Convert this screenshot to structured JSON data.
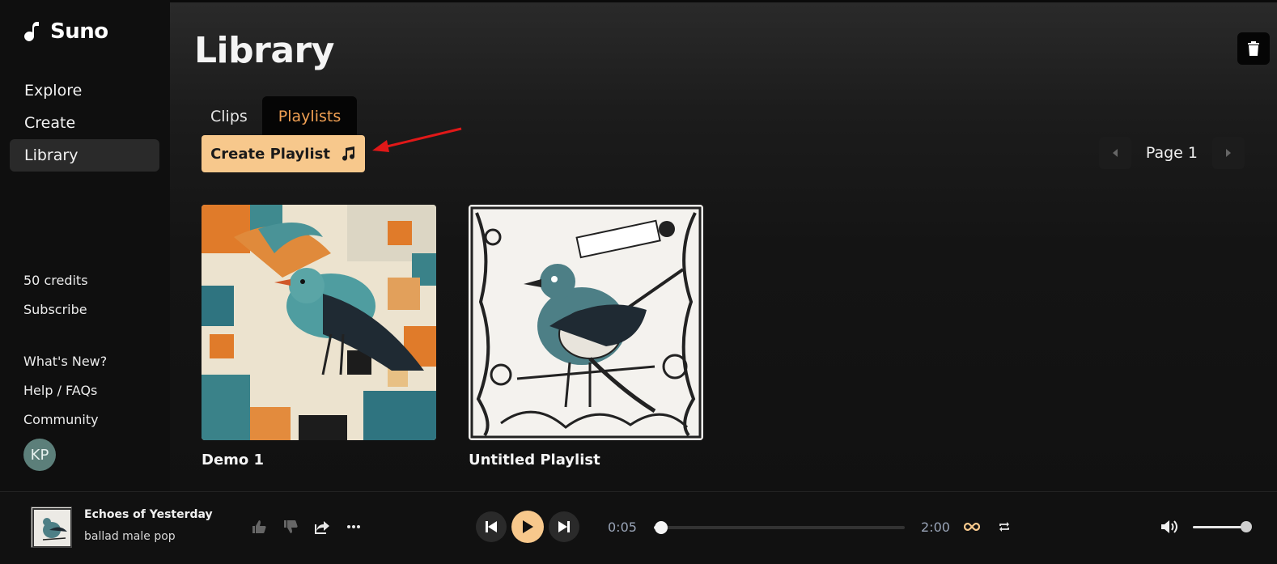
{
  "app": {
    "name": "Suno"
  },
  "sidebar": {
    "nav": [
      {
        "label": "Explore",
        "active": false
      },
      {
        "label": "Create",
        "active": false
      },
      {
        "label": "Library",
        "active": true
      }
    ],
    "credits": "50 credits",
    "subscribe": "Subscribe",
    "links": [
      "What's New?",
      "Help / FAQs",
      "Community"
    ],
    "avatar_initials": "KP"
  },
  "main": {
    "title": "Library",
    "tabs": [
      {
        "label": "Clips",
        "active": false
      },
      {
        "label": "Playlists",
        "active": true
      }
    ],
    "create_playlist_label": "Create Playlist",
    "pager": {
      "label": "Page 1"
    },
    "playlists": [
      {
        "title": "Demo 1"
      },
      {
        "title": "Untitled Playlist"
      }
    ]
  },
  "player": {
    "song_title": "Echoes of Yesterday",
    "song_tags": "ballad male pop",
    "elapsed": "0:05",
    "duration": "2:00",
    "progress_fraction": 0.03,
    "volume_fraction": 1.0
  },
  "colors": {
    "accent": "#f7c88c",
    "active_tab_text": "#f2a154",
    "annotation_arrow": "#e01818"
  }
}
